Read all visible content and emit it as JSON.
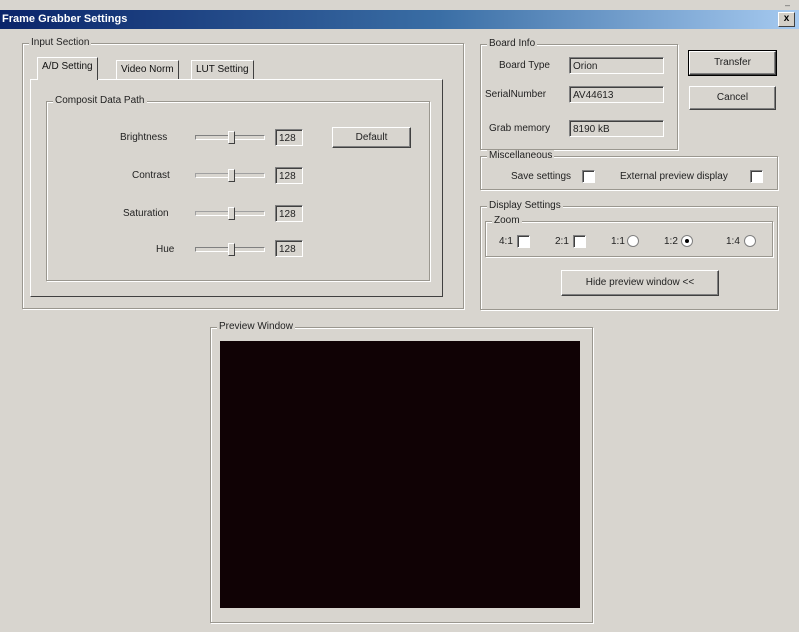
{
  "window": {
    "title": "Frame Grabber Settings",
    "close_label": "x",
    "corner_glyph": "–"
  },
  "input_section": {
    "legend": "Input Section",
    "tabs": [
      {
        "label": "A/D Setting",
        "active": true
      },
      {
        "label": "Video Norm",
        "active": false
      },
      {
        "label": "LUT Setting",
        "active": false
      }
    ],
    "group_legend": "Composit Data Path",
    "controls": [
      {
        "label": "Brightness",
        "value": "128",
        "level": 0.5,
        "enabled": true
      },
      {
        "label": "Contrast",
        "value": "128",
        "level": 0.5,
        "enabled": false
      },
      {
        "label": "Saturation",
        "value": "128",
        "level": 0.5,
        "enabled": false
      },
      {
        "label": "Hue",
        "value": "128",
        "level": 0.5,
        "enabled": true
      }
    ],
    "default_button": "Default"
  },
  "board_info": {
    "legend": "Board Info",
    "fields": [
      {
        "label": "Board Type",
        "value": "Orion"
      },
      {
        "label": "SerialNumber",
        "value": "AV44613"
      },
      {
        "label": "Grab memory",
        "value": "8190 kB"
      }
    ]
  },
  "buttons": {
    "transfer": "Transfer",
    "cancel": "Cancel"
  },
  "misc": {
    "legend": "Miscellaneous",
    "save_settings": {
      "label": "Save settings",
      "checked": false
    },
    "external_preview": {
      "label": "External preview display",
      "checked": false
    }
  },
  "display_settings": {
    "legend": "Display Settings",
    "zoom_legend": "Zoom",
    "zoom_options": [
      {
        "label": "4:1",
        "selected": false
      },
      {
        "label": "2:1",
        "selected": false
      },
      {
        "label": "1:1",
        "selected": false
      },
      {
        "label": "1:2",
        "selected": true
      },
      {
        "label": "1:4",
        "selected": false
      }
    ],
    "hide_preview_button": "Hide preview window <<"
  },
  "preview": {
    "legend": "Preview Window",
    "canvas_color": "#100205"
  }
}
